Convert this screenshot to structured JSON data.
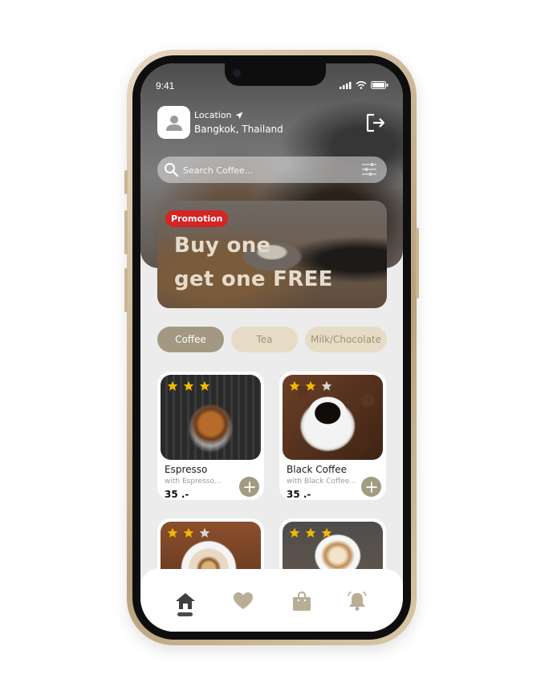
{
  "status_bar": {
    "time": "9:41"
  },
  "header": {
    "location_label": "Location",
    "location_value": "Bangkok, Thailand"
  },
  "search": {
    "placeholder": "Search Coffee..."
  },
  "promo": {
    "badge": "Promotion",
    "line1": "Buy one",
    "line2": "get one FREE"
  },
  "categories": [
    {
      "label": "Coffee",
      "active": true
    },
    {
      "label": "Tea",
      "active": false
    },
    {
      "label": "Milk/Chocolate",
      "active": false
    }
  ],
  "products": [
    {
      "name": "Espresso",
      "desc": "with Espresso...",
      "price": "35 .-",
      "rating": 3
    },
    {
      "name": "Black Coffee",
      "desc": "with Black Coffee...",
      "price": "35 .-",
      "rating": 2
    },
    {
      "name": "",
      "desc": "",
      "price": "",
      "rating": 2
    },
    {
      "name": "",
      "desc": "",
      "price": "",
      "rating": 3
    }
  ],
  "colors": {
    "accent": "#a39882",
    "tab_inactive": "#e6dcc6",
    "promo_badge": "#d42424",
    "star": "#f5b800",
    "star_empty": "#d6d6d6"
  },
  "icons": {
    "avatar": "user-icon",
    "location": "navigation-arrow-icon",
    "logout": "logout-icon",
    "search": "search-icon",
    "filter": "sliders-icon",
    "add": "plus-icon",
    "nav": [
      "home-icon",
      "heart-icon",
      "shopping-bag-icon",
      "bell-icon"
    ]
  }
}
